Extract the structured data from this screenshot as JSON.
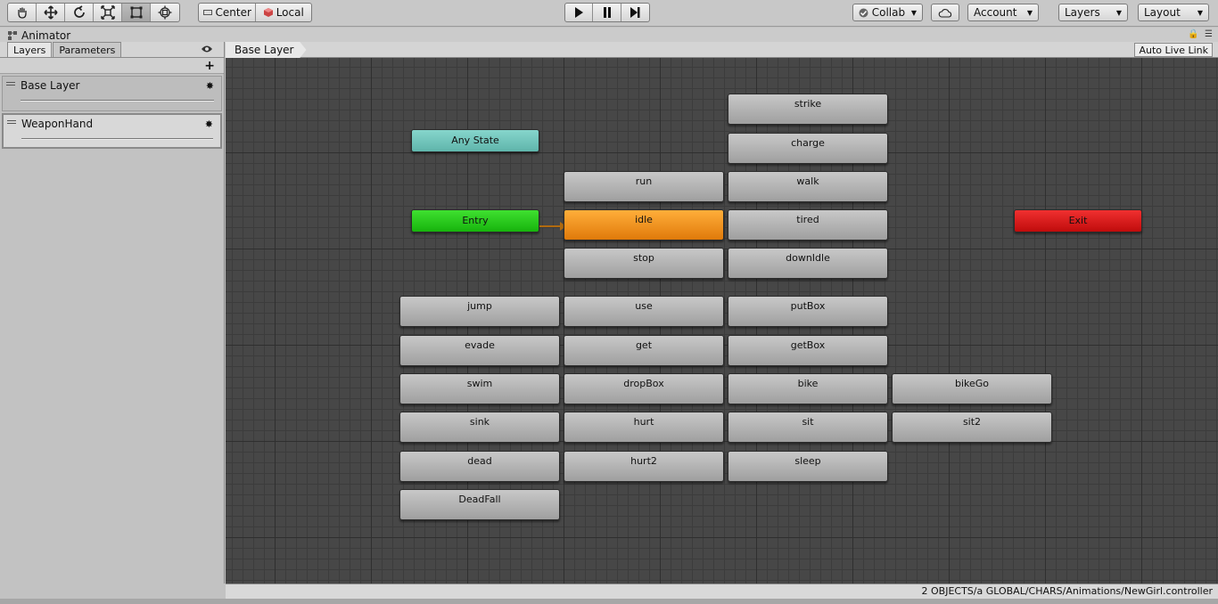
{
  "toolbar": {
    "tools": [
      {
        "name": "hand-tool",
        "icon": "hand-icon"
      },
      {
        "name": "move-tool",
        "icon": "move-icon"
      },
      {
        "name": "rotate-tool",
        "icon": "rotate-icon"
      },
      {
        "name": "scale-tool",
        "icon": "scale-icon"
      },
      {
        "name": "rect-tool",
        "icon": "rect-icon"
      },
      {
        "name": "transform-tool",
        "icon": "transform-icon"
      }
    ],
    "pivot_label": "Center",
    "space_label": "Local",
    "collab_label": "Collab",
    "account_label": "Account",
    "layers_label": "Layers",
    "layout_label": "Layout"
  },
  "window": {
    "title": "Animator"
  },
  "left_panel": {
    "tab_layers": "Layers",
    "tab_parameters": "Parameters",
    "layers": [
      {
        "name": "Base Layer"
      },
      {
        "name": "WeaponHand"
      }
    ]
  },
  "graph": {
    "breadcrumb": "Base Layer",
    "auto_live_link": "Auto Live Link",
    "special_states": {
      "any_state": "Any State",
      "entry": "Entry",
      "exit": "Exit"
    },
    "default_state": "idle",
    "states": {
      "strike": "strike",
      "charge": "charge",
      "run": "run",
      "walk": "walk",
      "tired": "tired",
      "stop": "stop",
      "downIdle": "downIdle",
      "jump": "jump",
      "use": "use",
      "putBox": "putBox",
      "evade": "evade",
      "get": "get",
      "getBox": "getBox",
      "swim": "swim",
      "dropBox": "dropBox",
      "bike": "bike",
      "bikeGo": "bikeGo",
      "sink": "sink",
      "hurt": "hurt",
      "sit": "sit",
      "sit2": "sit2",
      "dead": "dead",
      "hurt2": "hurt2",
      "sleep": "sleep",
      "DeadFall": "DeadFall"
    }
  },
  "status": {
    "path": "2 OBJECTS/a GLOBAL/CHARS/Animations/NewGirl.controller"
  },
  "colors": {
    "any_state": "#6fc4ba",
    "entry": "#22c218",
    "exit": "#d81a1a",
    "default_state": "#f08c1c",
    "state": "#b3b3b3",
    "graph_bg": "#474747"
  }
}
